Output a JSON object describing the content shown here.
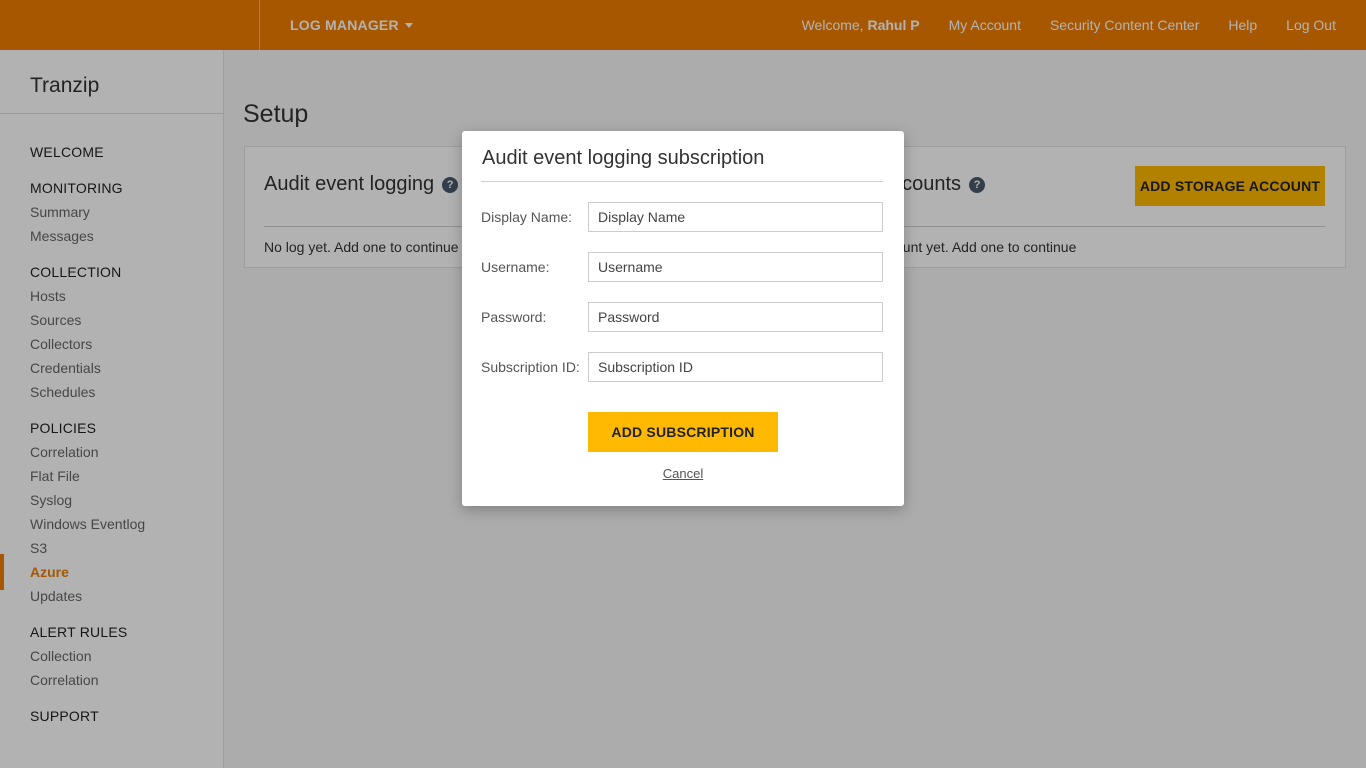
{
  "topbar": {
    "app_menu": "LOG MANAGER",
    "welcome_prefix": "Welcome,",
    "user_name": "Rahul P",
    "links": [
      "My Account",
      "Security Content Center",
      "Help",
      "Log Out"
    ],
    "accent_color": "#ef7d00"
  },
  "sidebar": {
    "company": "Tranzip",
    "welcome": "WELCOME",
    "monitoring": {
      "title": "MONITORING",
      "items": [
        "Summary",
        "Messages"
      ]
    },
    "collection": {
      "title": "COLLECTION",
      "items": [
        "Hosts",
        "Sources",
        "Collectors",
        "Credentials",
        "Schedules"
      ]
    },
    "policies": {
      "title": "POLICIES",
      "items": [
        "Correlation",
        "Flat File",
        "Syslog",
        "Windows Eventlog",
        "S3",
        "Azure",
        "Updates"
      ]
    },
    "alert_rules": {
      "title": "ALERT RULES",
      "items": [
        "Collection",
        "Correlation"
      ]
    },
    "support": "SUPPORT",
    "active_item": "Azure"
  },
  "main": {
    "page_title": "Setup",
    "left_panel": {
      "title": "Audit event logging",
      "empty_text": "No log yet. Add one to continue"
    },
    "right_panel": {
      "title": "accounts",
      "empty_text": "ccount yet. Add one to continue",
      "button": "ADD STORAGE ACCOUNT"
    }
  },
  "modal": {
    "title": "Audit event logging subscription",
    "fields": [
      {
        "label": "Display Name:",
        "placeholder": "Display Name"
      },
      {
        "label": "Username:",
        "placeholder": "Username"
      },
      {
        "label": "Password:",
        "placeholder": "Password"
      },
      {
        "label": "Subscription ID:",
        "placeholder": "Subscription ID"
      }
    ],
    "submit": "ADD SUBSCRIPTION",
    "cancel": "Cancel",
    "button_color": "#ffb900"
  }
}
